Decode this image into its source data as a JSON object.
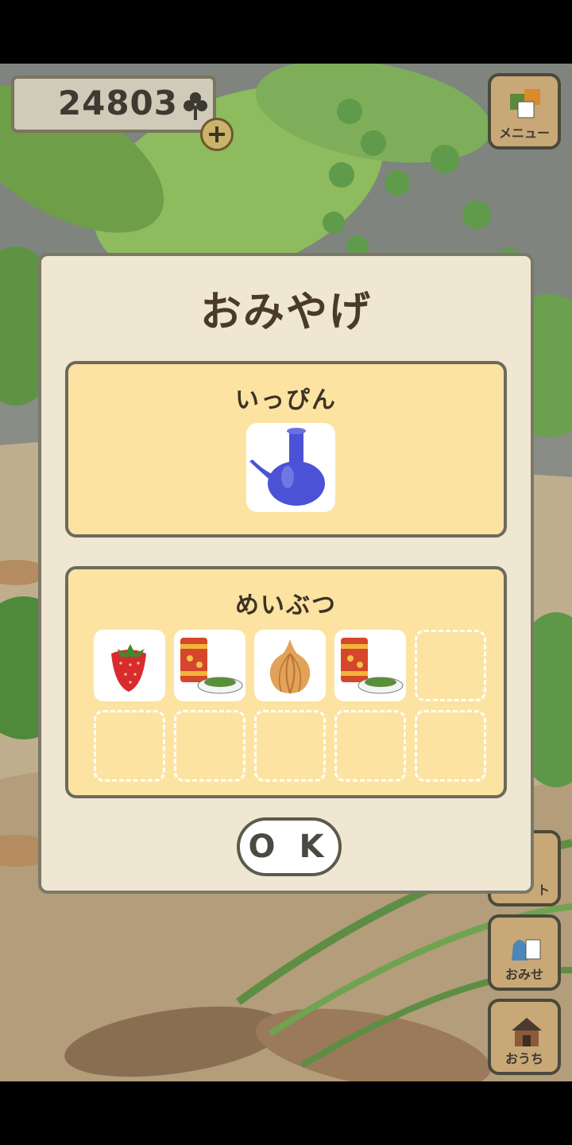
{
  "clover_count": "24803",
  "side_menu": [
    {
      "id": "menu",
      "label": "メニュー",
      "icon": "menu-notes-icon"
    },
    {
      "id": "shop",
      "label": "おみせ",
      "icon": "shop-bag-icon"
    },
    {
      "id": "home",
      "label": "おうち",
      "icon": "house-icon"
    }
  ],
  "partial_button_label": "ト",
  "dialog": {
    "title": "おみやげ",
    "treasure_section": {
      "title": "いっぴん",
      "item": {
        "icon": "blue-vase-icon"
      }
    },
    "specialty_section": {
      "title": "めいぶつ",
      "items": [
        {
          "icon": "strawberry-icon"
        },
        {
          "icon": "tea-canister-icon"
        },
        {
          "icon": "onion-icon"
        },
        {
          "icon": "tea-canister-icon"
        }
      ],
      "total_slots": 10
    },
    "ok_label": "O K"
  },
  "colors": {
    "panel": "#fde3a2",
    "dialog_bg": "#efe7d2",
    "leaf_green": "#7fae5a"
  }
}
